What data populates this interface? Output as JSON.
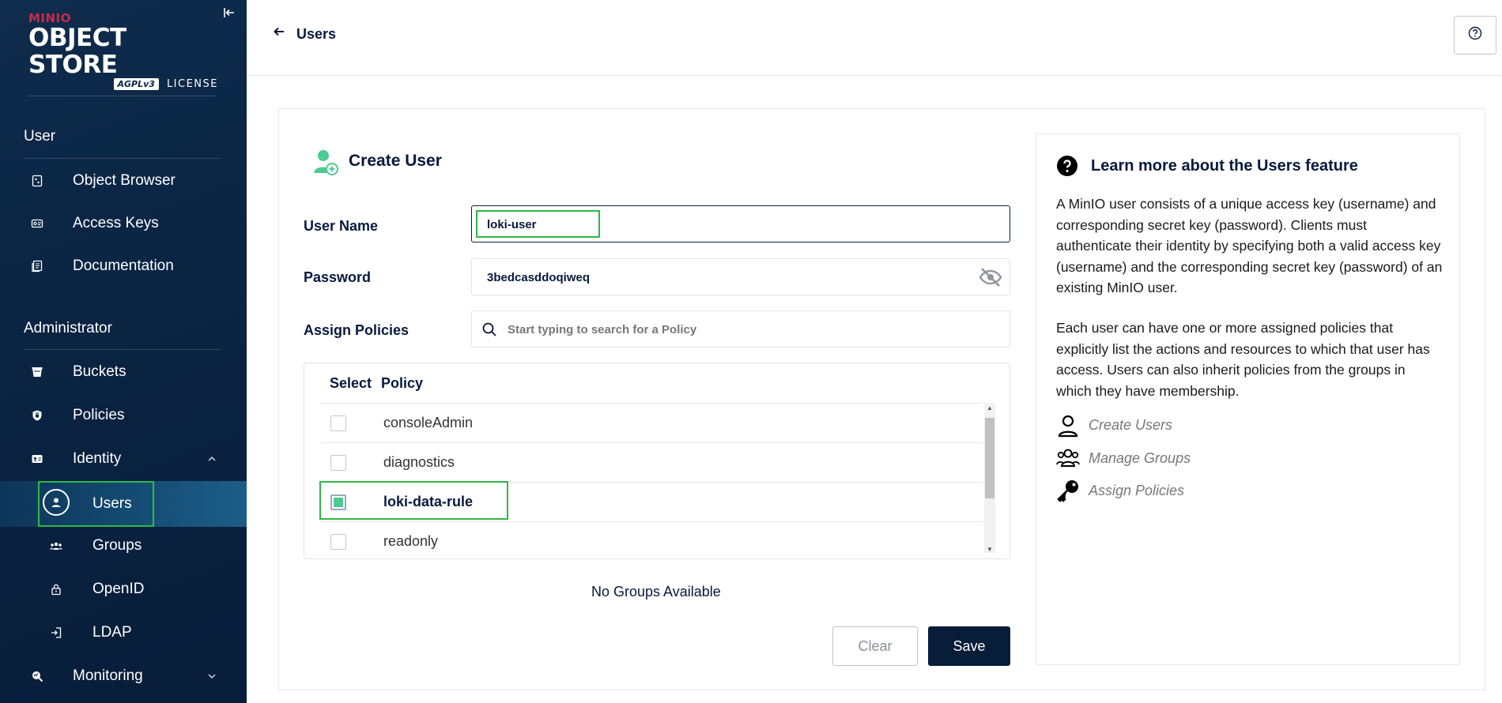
{
  "sidebar": {
    "logo": {
      "brand": "MINIO",
      "product": "OBJECT STORE",
      "badge": "AGPLv3",
      "license": "LICENSE"
    },
    "sections": [
      {
        "title": "User",
        "items": [
          {
            "label": "Object Browser",
            "icon": "object-browser-icon"
          },
          {
            "label": "Access Keys",
            "icon": "access-keys-icon"
          },
          {
            "label": "Documentation",
            "icon": "documentation-icon"
          }
        ]
      },
      {
        "title": "Administrator",
        "items": [
          {
            "label": "Buckets",
            "icon": "bucket-icon"
          },
          {
            "label": "Policies",
            "icon": "shield-icon"
          },
          {
            "label": "Identity",
            "icon": "identity-icon",
            "expanded": true,
            "children": [
              {
                "label": "Users",
                "icon": "user-icon",
                "active": true
              },
              {
                "label": "Groups",
                "icon": "groups-icon"
              },
              {
                "label": "OpenID",
                "icon": "lock-icon"
              },
              {
                "label": "LDAP",
                "icon": "login-icon"
              }
            ]
          },
          {
            "label": "Monitoring",
            "icon": "monitoring-icon",
            "expanded": false
          }
        ]
      }
    ]
  },
  "header": {
    "back_label": "Users",
    "help_icon": "help-icon"
  },
  "form": {
    "title": "Create User",
    "username": {
      "label": "User Name",
      "value": "loki-user"
    },
    "password": {
      "label": "Password",
      "value": "3bedcasddoqiweq"
    },
    "policies": {
      "label": "Assign Policies",
      "search_placeholder": "Start typing to search for a Policy",
      "columns": [
        "Select",
        "Policy"
      ],
      "rows": [
        {
          "name": "consoleAdmin",
          "checked": false
        },
        {
          "name": "diagnostics",
          "checked": false
        },
        {
          "name": "loki-data-rule",
          "checked": true
        },
        {
          "name": "readonly",
          "checked": false
        }
      ]
    },
    "groups_message": "No Groups Available",
    "clear_label": "Clear",
    "save_label": "Save"
  },
  "help": {
    "title": "Learn more about the Users feature",
    "paragraphs": [
      "A MinIO user consists of a unique access key (username) and corresponding secret key (password). Clients must authenticate their identity by specifying both a valid access key (username) and the corresponding secret key (password) of an existing MinIO user.",
      "Each user can have one or more assigned policies that explicitly list the actions and resources to which that user has access. Users can also inherit policies from the groups in which they have membership."
    ],
    "links": [
      {
        "label": "Create Users",
        "icon": "user-outline-icon"
      },
      {
        "label": "Manage Groups",
        "icon": "groups-outline-icon"
      },
      {
        "label": "Assign Policies",
        "icon": "key-icon"
      }
    ]
  },
  "colors": {
    "sidebar_bg": "#0a2442",
    "accent_green": "#4ccb92",
    "highlight": "#2fb845",
    "primary": "#081d3a"
  }
}
